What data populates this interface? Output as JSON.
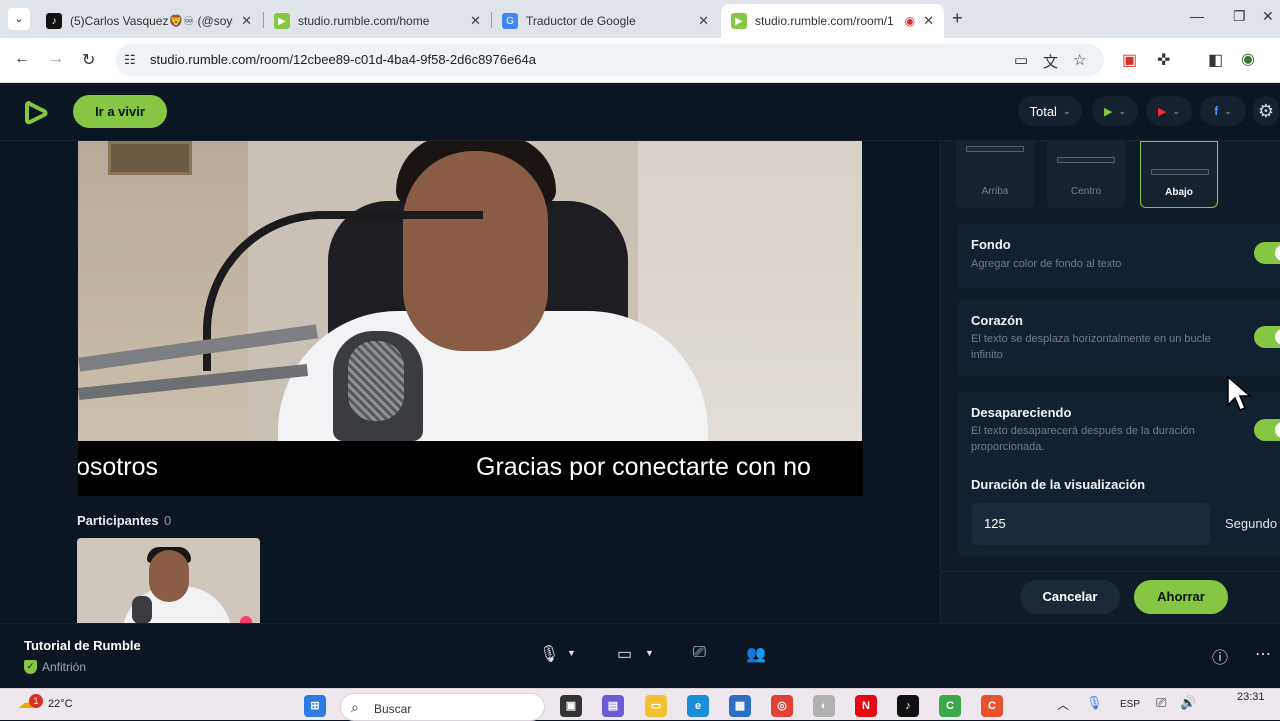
{
  "browser": {
    "tabs": [
      {
        "title": "(5)Carlos Vasquez🦁♾ (@soyc",
        "fav_color": "#111111",
        "fav_glyph": "♪"
      },
      {
        "title": "studio.rumble.com/home",
        "fav_color": "#85c742",
        "fav_glyph": "▶"
      },
      {
        "title": "Traductor de Google",
        "fav_color": "#4285f4",
        "fav_glyph": "G"
      },
      {
        "title": "studio.rumble.com/room/1",
        "fav_color": "#85c742",
        "fav_glyph": "▶"
      }
    ],
    "tab_close": "✕",
    "new_tab": "+",
    "url": "studio.rumble.com/room/12cbee89-c01d-4ba4-9f58-2d6c8976e64a"
  },
  "header": {
    "go_live_label": "Ir a vivir",
    "total_label": "Total",
    "chev": "⌄"
  },
  "stage": {
    "caption_left": "osotros",
    "caption_right": "Gracias por conectarte con no",
    "participants_label": "Participantes",
    "participants_count": "0"
  },
  "panel": {
    "positions": [
      {
        "label": "Arriba",
        "selected": false
      },
      {
        "label": "Centro",
        "selected": false
      },
      {
        "label": "Abajo",
        "selected": true
      }
    ],
    "options": [
      {
        "title": "Fondo",
        "desc": "Agregar color de fondo al texto",
        "enabled": true
      },
      {
        "title": "Corazón",
        "desc": "El texto se desplaza horizontalmente en un bucle infinito",
        "enabled": true
      },
      {
        "title": "Desapareciendo",
        "desc": "El texto desaparecerá después de la duración proporcionada.",
        "enabled": true
      }
    ],
    "duration_label": "Duración de la visualización",
    "duration_value": "125",
    "duration_unit": "Segundo",
    "cancel_label": "Cancelar",
    "save_label": "Ahorrar"
  },
  "footer": {
    "room_title": "Tutorial de Rumble",
    "room_role": "Anfitrión"
  },
  "taskbar": {
    "temperature": "22°C",
    "weather_badge": "1",
    "search_placeholder": "Buscar",
    "language": "ESP",
    "time": "23:31"
  },
  "colors": {
    "accent": "#85c742",
    "background": "#0b1622"
  }
}
